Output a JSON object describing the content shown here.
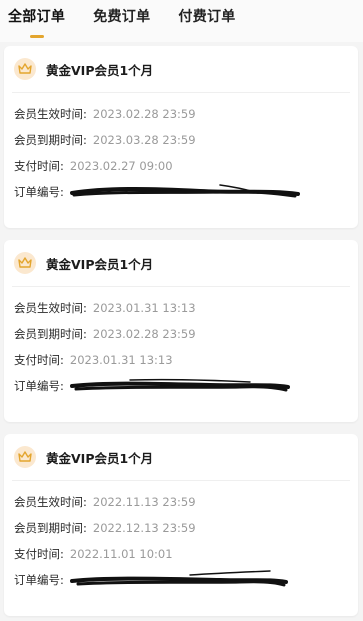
{
  "tabs": [
    {
      "label": "全部订单",
      "active": true
    },
    {
      "label": "免费订单",
      "active": false
    },
    {
      "label": "付费订单",
      "active": false
    }
  ],
  "colors": {
    "accent": "#e3a52e",
    "badge_bg": "#fbe8cf",
    "value_text": "#9a9a9a"
  },
  "orders": [
    {
      "icon": "crown-icon",
      "title": "黄金VIP会员1个月",
      "start_label": "会员生效时间:",
      "start_value": "2023.02.28 23:59",
      "end_label": "会员到期时间:",
      "end_value": "2023.03.28 23:59",
      "paid_label": "支付时间:",
      "paid_value": "2023.02.27 09:00",
      "order_no_label": "订单编号:"
    },
    {
      "icon": "crown-icon",
      "title": "黄金VIP会员1个月",
      "start_label": "会员生效时间:",
      "start_value": "2023.01.31 13:13",
      "end_label": "会员到期时间:",
      "end_value": "2023.02.28 23:59",
      "paid_label": "支付时间:",
      "paid_value": "2023.01.31 13:13",
      "order_no_label": "订单编号:"
    },
    {
      "icon": "crown-icon",
      "title": "黄金VIP会员1个月",
      "start_label": "会员生效时间:",
      "start_value": "2022.11.13 23:59",
      "end_label": "会员到期时间:",
      "end_value": "2022.12.13 23:59",
      "paid_label": "支付时间:",
      "paid_value": "2022.11.01 10:01",
      "order_no_label": "订单编号:"
    }
  ]
}
